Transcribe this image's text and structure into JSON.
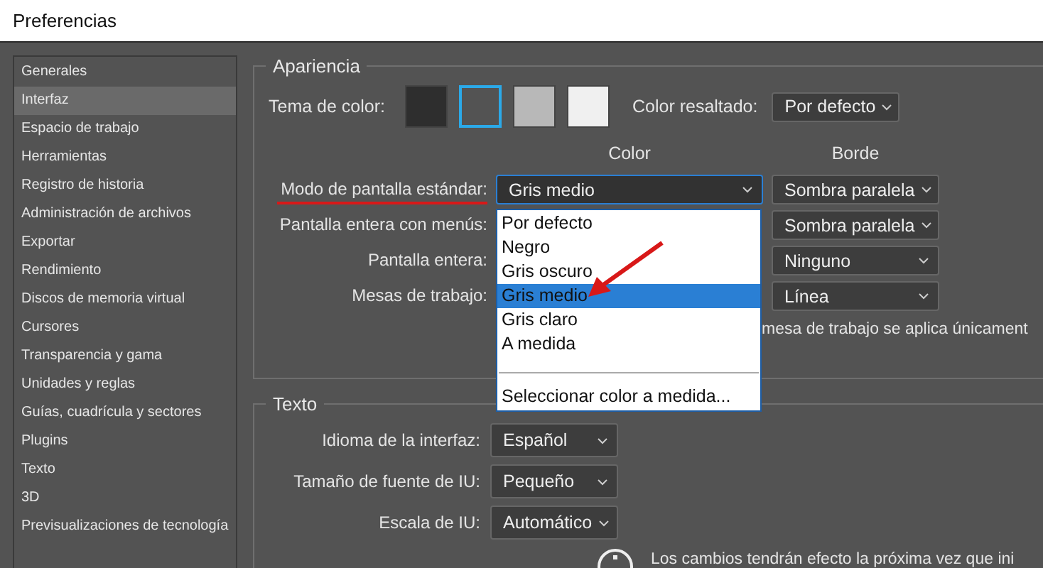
{
  "window": {
    "title": "Preferencias"
  },
  "sidebar": {
    "items": [
      {
        "label": "Generales",
        "selected": false
      },
      {
        "label": "Interfaz",
        "selected": true
      },
      {
        "label": "Espacio de trabajo",
        "selected": false
      },
      {
        "label": "Herramientas",
        "selected": false
      },
      {
        "label": "Registro de historia",
        "selected": false
      },
      {
        "label": "Administración de archivos",
        "selected": false
      },
      {
        "label": "Exportar",
        "selected": false
      },
      {
        "label": "Rendimiento",
        "selected": false
      },
      {
        "label": "Discos de memoria virtual",
        "selected": false
      },
      {
        "label": "Cursores",
        "selected": false
      },
      {
        "label": "Transparencia y gama",
        "selected": false
      },
      {
        "label": "Unidades y reglas",
        "selected": false
      },
      {
        "label": "Guías, cuadrícula y sectores",
        "selected": false
      },
      {
        "label": "Plugins",
        "selected": false
      },
      {
        "label": "Texto",
        "selected": false
      },
      {
        "label": "3D",
        "selected": false
      },
      {
        "label": "Previsualizaciones de tecnología",
        "selected": false
      }
    ]
  },
  "appearance": {
    "title": "Apariencia",
    "theme_label": "Tema de color:",
    "themes": [
      {
        "color": "#2e2e2e",
        "selected": false
      },
      {
        "color": "#535353",
        "selected": true
      },
      {
        "color": "#b8b8b8",
        "selected": false
      },
      {
        "color": "#f0f0f0",
        "selected": false
      }
    ],
    "highlight_label": "Color resaltado:",
    "highlight_value": "Por defecto",
    "column_headers": [
      "Color",
      "Borde"
    ],
    "rows": [
      {
        "label": "Modo de pantalla estándar:",
        "color_value": "Gris medio",
        "border_value": "Sombra paralela",
        "underlined": true
      },
      {
        "label": "Pantalla entera con menús:",
        "border_value": "Sombra paralela",
        "underlined": false
      },
      {
        "label": "Pantalla entera:",
        "border_value": "Ninguno",
        "underlined": false
      },
      {
        "label": "Mesas de trabajo:",
        "border_value": "Línea",
        "underlined": false
      }
    ],
    "note": "mesa de trabajo se aplica únicament"
  },
  "color_menu": {
    "options": [
      {
        "label": "Por defecto",
        "selected": false
      },
      {
        "label": "Negro",
        "selected": false
      },
      {
        "label": "Gris oscuro",
        "selected": false
      },
      {
        "label": "Gris medio",
        "selected": true
      },
      {
        "label": "Gris claro",
        "selected": false
      },
      {
        "label": "A medida",
        "selected": false
      }
    ],
    "custom": "Seleccionar color a medida..."
  },
  "text": {
    "title": "Texto",
    "rows": [
      {
        "label": "Idioma de la interfaz:",
        "value": "Español"
      },
      {
        "label": "Tamaño de fuente de IU:",
        "value": "Pequeño"
      },
      {
        "label": "Escala de IU:",
        "value": "Automático"
      }
    ],
    "info": "Los cambios tendrán efecto la próxima vez que ini"
  }
}
